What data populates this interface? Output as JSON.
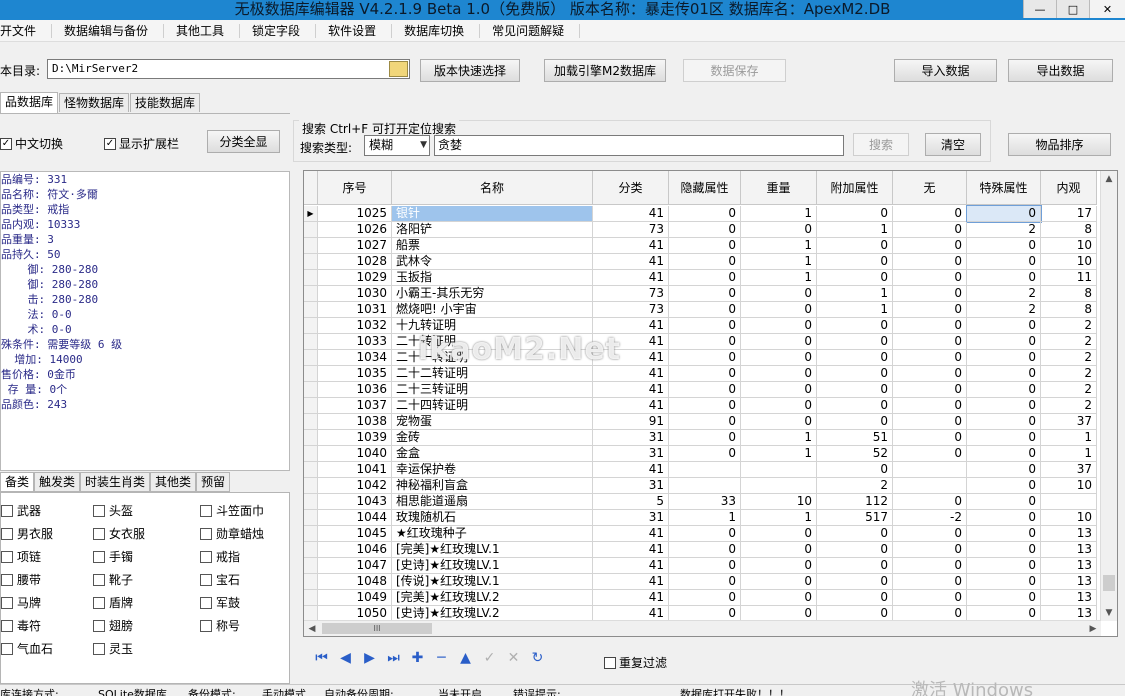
{
  "window": {
    "title": "无极数据库编辑器 V4.2.1.9    Beta 1.0（免费版）    版本名称：暴走传01区    数据库名：ApexM2.DB"
  },
  "menu": [
    "开文件",
    "数据编辑与备份",
    "其他工具",
    "锁定字段",
    "软件设置",
    "数据库切换",
    "常见问题解疑"
  ],
  "path": {
    "label": "本目录:",
    "value": "D:\\MirServer2"
  },
  "buttons": {
    "version_select": "版本快速选择",
    "load_engine": "加载引擎M2数据库",
    "save_data": "数据保存",
    "import": "导入数据",
    "export": "导出数据",
    "category_all": "分类全显",
    "search": "搜索",
    "clear": "清空",
    "item_sort": "物品排序"
  },
  "tabs": [
    "品数据库",
    "怪物数据库",
    "技能数据库"
  ],
  "options": {
    "chinese_switch": "中文切换",
    "show_ext": "显示扩展栏",
    "repeat_filter": "重复过滤"
  },
  "search": {
    "group_title": "搜索  Ctrl+F 可打开定位搜索",
    "type_label": "搜索类型:",
    "type_value": "模糊",
    "query": "贪婪"
  },
  "item_info": [
    "品编号: 331",
    "品名称: 符文·多爾",
    "品类型: 戒指",
    "品内观: 10333",
    "品重量: 3",
    "品持久: 50",
    "    御: 280-280",
    "    御: 280-280",
    "    击: 280-280",
    "    法: 0-0",
    "    术: 0-0",
    "殊条件: 需要等级 6 级",
    "  增加: 14000",
    "售价格: 0金币",
    " 存 量: 0个",
    "品颜色: 243"
  ],
  "category_tabs": [
    "备类",
    "触发类",
    "时装生肖类",
    "其他类",
    "预留"
  ],
  "categories": [
    [
      "武器",
      "头盔",
      "斗笠面巾"
    ],
    [
      "男衣服",
      "女衣服",
      "勋章蜡烛"
    ],
    [
      "项链",
      "手镯",
      "戒指"
    ],
    [
      "腰带",
      "靴子",
      "宝石"
    ],
    [
      "马牌",
      "盾牌",
      "军鼓"
    ],
    [
      "毒符",
      "翅膀",
      "称号"
    ],
    [
      "气血石",
      "灵玉",
      ""
    ]
  ],
  "table": {
    "columns": [
      "序号",
      "名称",
      "分类",
      "隐藏属性",
      "重量",
      "附加属性",
      "无",
      "特殊属性",
      "内观"
    ],
    "rows": [
      [
        "1025",
        "银针",
        "41",
        "0",
        "1",
        "0",
        "0",
        "0",
        "17"
      ],
      [
        "1026",
        "洛阳铲",
        "73",
        "0",
        "0",
        "1",
        "0",
        "2",
        "8"
      ],
      [
        "1027",
        "船票",
        "41",
        "0",
        "1",
        "0",
        "0",
        "0",
        "10"
      ],
      [
        "1028",
        "武林令",
        "41",
        "0",
        "1",
        "0",
        "0",
        "0",
        "10"
      ],
      [
        "1029",
        "玉扳指",
        "41",
        "0",
        "1",
        "0",
        "0",
        "0",
        "11"
      ],
      [
        "1030",
        "小霸王-其乐无穷",
        "73",
        "0",
        "0",
        "1",
        "0",
        "2",
        "8"
      ],
      [
        "1031",
        "燃烧吧! 小宇宙",
        "73",
        "0",
        "0",
        "1",
        "0",
        "2",
        "8"
      ],
      [
        "1032",
        "十九转证明",
        "41",
        "0",
        "0",
        "0",
        "0",
        "0",
        "2"
      ],
      [
        "1033",
        "二十转证明",
        "41",
        "0",
        "0",
        "0",
        "0",
        "0",
        "2"
      ],
      [
        "1034",
        "二十一转证明",
        "41",
        "0",
        "0",
        "0",
        "0",
        "0",
        "2"
      ],
      [
        "1035",
        "二十二转证明",
        "41",
        "0",
        "0",
        "0",
        "0",
        "0",
        "2"
      ],
      [
        "1036",
        "二十三转证明",
        "41",
        "0",
        "0",
        "0",
        "0",
        "0",
        "2"
      ],
      [
        "1037",
        "二十四转证明",
        "41",
        "0",
        "0",
        "0",
        "0",
        "0",
        "2"
      ],
      [
        "1038",
        "宠物蛋",
        "91",
        "0",
        "0",
        "0",
        "0",
        "0",
        "37"
      ],
      [
        "1039",
        "金砖",
        "31",
        "0",
        "1",
        "51",
        "0",
        "0",
        "1"
      ],
      [
        "1040",
        "金盒",
        "31",
        "0",
        "1",
        "52",
        "0",
        "0",
        "1"
      ],
      [
        "1041",
        "幸运保护卷",
        "41",
        "",
        "",
        "0",
        "",
        "0",
        "37"
      ],
      [
        "1042",
        "神秘福利盲盒",
        "31",
        "",
        "",
        "2",
        "",
        "0",
        "10"
      ],
      [
        "1043",
        "相思能道遥扇",
        "5",
        "33",
        "10",
        "112",
        "0",
        "0",
        ""
      ],
      [
        "1044",
        "玫瑰随机石",
        "31",
        "1",
        "1",
        "517",
        "-2",
        "0",
        "10"
      ],
      [
        "1045",
        "★红玫瑰种子",
        "41",
        "0",
        "0",
        "0",
        "0",
        "0",
        "13"
      ],
      [
        "1046",
        "[完美]★红玫瑰LV.1",
        "41",
        "0",
        "0",
        "0",
        "0",
        "0",
        "13"
      ],
      [
        "1047",
        "[史诗]★红玫瑰LV.1",
        "41",
        "0",
        "0",
        "0",
        "0",
        "0",
        "13"
      ],
      [
        "1048",
        "[传说]★红玫瑰LV.1",
        "41",
        "0",
        "0",
        "0",
        "0",
        "0",
        "13"
      ],
      [
        "1049",
        "[完美]★红玫瑰LV.2",
        "41",
        "0",
        "0",
        "0",
        "0",
        "0",
        "13"
      ],
      [
        "1050",
        "[史诗]★红玫瑰LV.2",
        "41",
        "0",
        "0",
        "0",
        "0",
        "0",
        "13"
      ]
    ]
  },
  "scrollbar": {
    "hscroll_label": "III"
  },
  "watermark": "ikaoM2.Net",
  "status": [
    "库连接方式:",
    "SQLite数据库",
    "备份模式:",
    "手动模式",
    "自动备份周期:",
    "当未开启",
    "错误提示:",
    "数据库打开失败！！！"
  ],
  "activate": "激活 Windows"
}
